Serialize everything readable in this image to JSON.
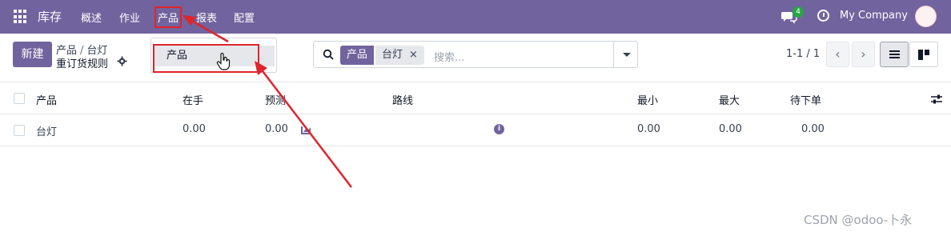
{
  "navbar": {
    "app_name": "库存",
    "menu": [
      "概述",
      "作业",
      "产品",
      "报表",
      "配置"
    ],
    "chat_count": "4",
    "company": "My Company"
  },
  "control": {
    "new_label": "新建",
    "breadcrumb": [
      "产品",
      "台灯"
    ],
    "breadcrumb_sep": "/",
    "title": "重订货规则"
  },
  "dropdown": {
    "items": [
      "产品"
    ]
  },
  "search": {
    "facet_key": "产品",
    "facet_value": "台灯",
    "facet_close": "×",
    "placeholder": "搜索..."
  },
  "pager": {
    "range": "1-1 / 1",
    "prev": "‹",
    "next": "›"
  },
  "table": {
    "headers": [
      "产品",
      "在手",
      "预测",
      "路线",
      "最小",
      "最大",
      "待下单"
    ],
    "rows": [
      {
        "product": "台灯",
        "on_hand": "0.00",
        "forecast": "0.00",
        "min": "0.00",
        "max": "0.00",
        "to_order": "0.00"
      }
    ]
  },
  "watermark": "CSDN @odoo-卜永",
  "colors": {
    "brand": "#71639e",
    "annotation": "#e0242b",
    "badge": "#28a745"
  }
}
